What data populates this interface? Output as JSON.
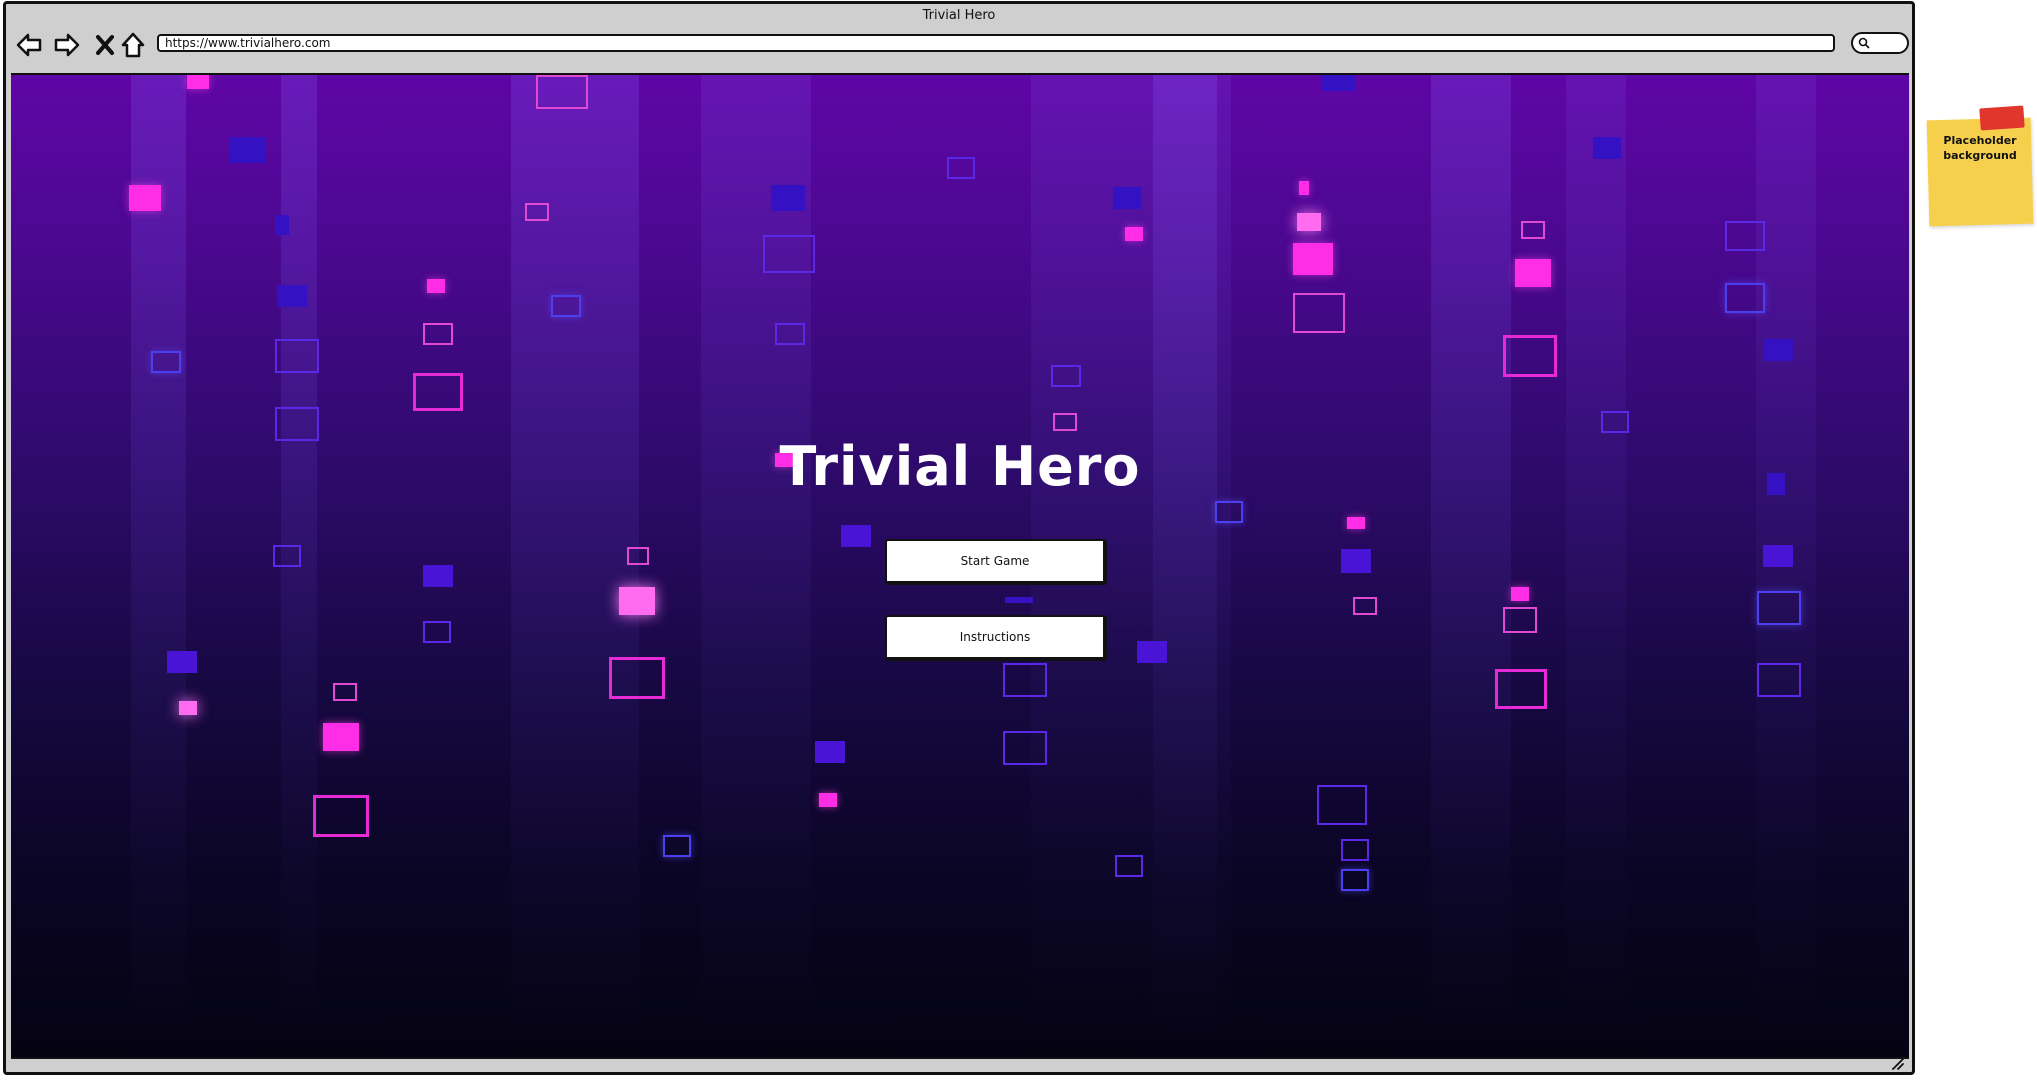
{
  "window": {
    "title": "Trivial Hero",
    "url": "https://www.trivialhero.com"
  },
  "toolbar": {
    "icons": [
      "back-arrow-icon",
      "forward-arrow-icon",
      "close-icon",
      "home-icon",
      "search-icon"
    ]
  },
  "hero": {
    "title": "Trivial Hero",
    "start_label": "Start Game",
    "instructions_label": "Instructions"
  },
  "sticky_note": {
    "text": "Placeholder background"
  },
  "colors": {
    "bg_top": "#5f06a6",
    "bg_bottom": "#050312",
    "accent_pink": "#ff2ee6",
    "accent_purple": "#4a14d6",
    "sticky": "#f6d04d"
  }
}
